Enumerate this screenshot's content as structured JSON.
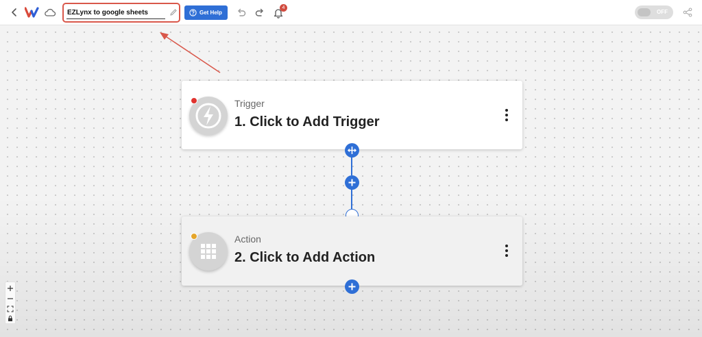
{
  "toolbar": {
    "workflow_name": "EZLynx to google sheets",
    "help_label": "Get Help",
    "notification_count": "4",
    "toggle_label": "OFF"
  },
  "flow": {
    "trigger": {
      "type_label": "Trigger",
      "title": "1. Click to Add Trigger"
    },
    "action": {
      "type_label": "Action",
      "title": "2. Click to Add Action"
    }
  },
  "icons": {
    "back": "chevron-left-icon",
    "logo": "w-logo-icon",
    "cloud": "cloud-icon",
    "edit": "pencil-icon",
    "help": "question-circle-icon",
    "undo": "undo-icon",
    "redo": "redo-icon",
    "notifications": "bell-icon",
    "share": "share-icon",
    "trigger": "lightning-bolt-icon",
    "action": "app-grid-icon",
    "zoom_in": "plus-icon",
    "zoom_out": "minus-icon",
    "fit": "fit-screen-icon",
    "lock": "lock-icon"
  },
  "colors": {
    "accent": "#2f6fd6",
    "highlight": "#d9574a",
    "trigger_status": "#e0332f",
    "action_status": "#e5a52a"
  }
}
